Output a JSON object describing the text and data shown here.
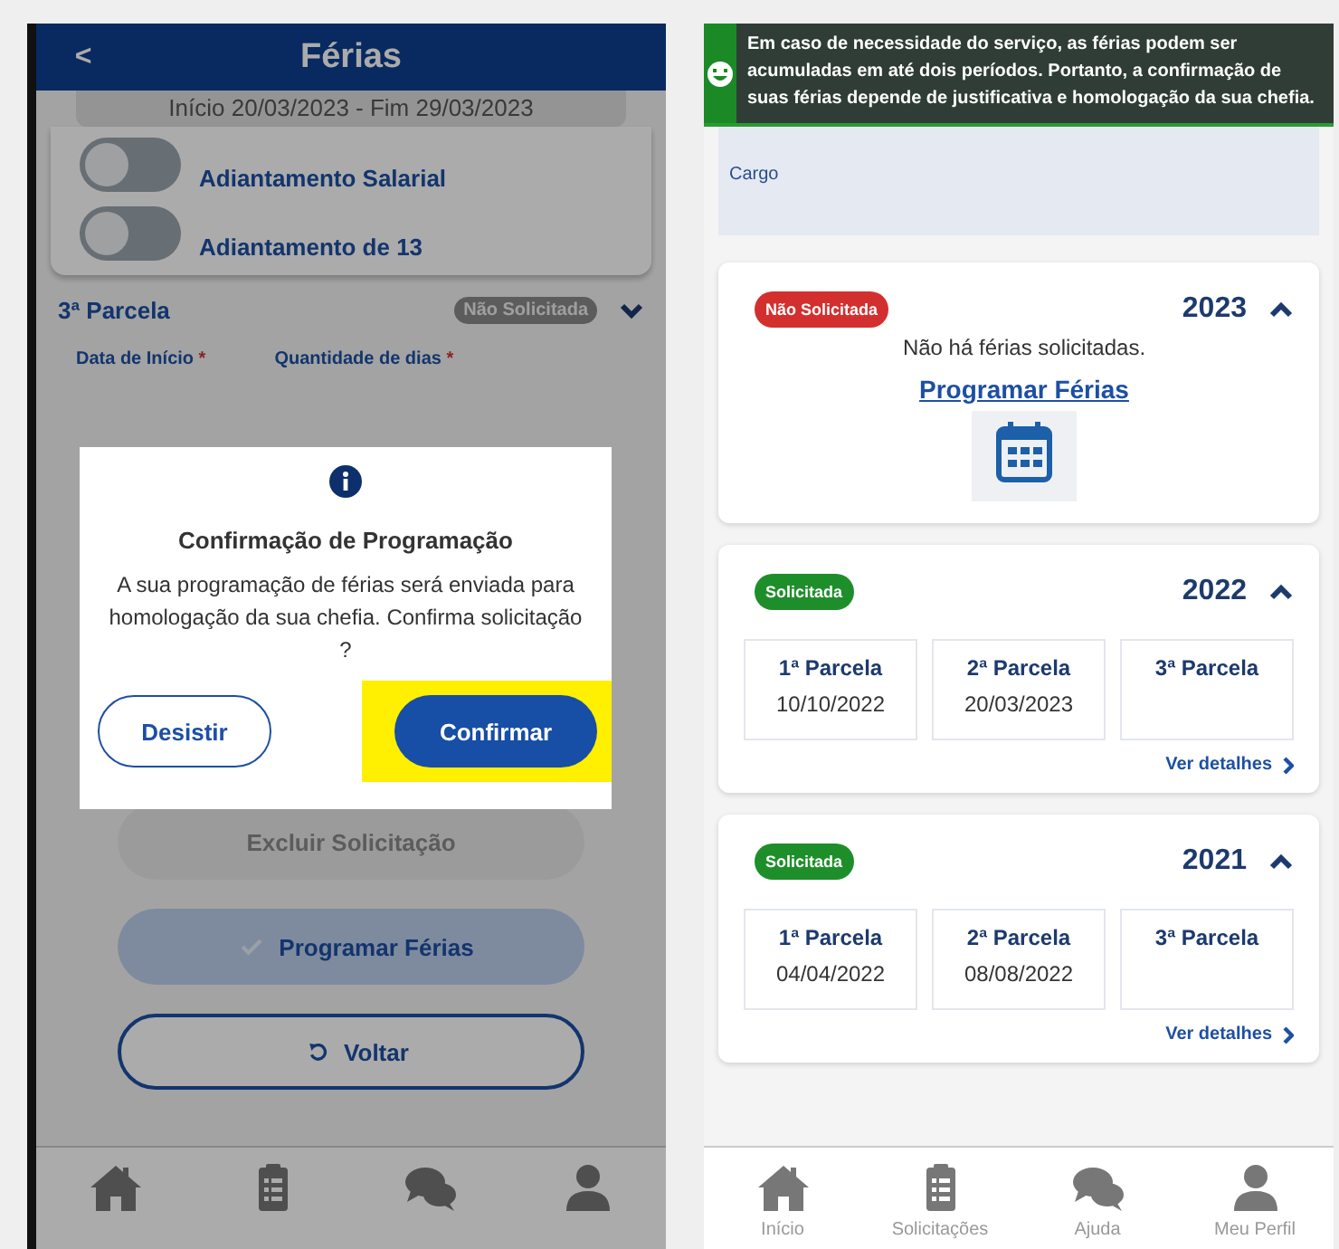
{
  "left_screen": {
    "header": {
      "back": "<",
      "title": "Férias"
    },
    "period": "Início 20/03/2023 - Fim 29/03/2023",
    "toggles": [
      {
        "label": "Adiantamento Salarial",
        "on": false
      },
      {
        "label": "Adiantamento de 13",
        "on": false
      }
    ],
    "parcel": {
      "title": "3ª Parcela",
      "status": "Não Solicitada",
      "expanded": false,
      "fields": [
        {
          "label": "Data de Início",
          "mark": "*"
        },
        {
          "label": "Quantidade de dias",
          "mark": "*"
        }
      ]
    },
    "actions": [
      {
        "label": "Excluir Solicitação",
        "kind": "disabled"
      },
      {
        "label": "Programar Férias",
        "kind": "primary"
      },
      {
        "label": "Voltar",
        "kind": "outline"
      }
    ],
    "dialog": {
      "title": "Confirmação de Programação",
      "message": "A sua programação de férias será enviada para homologação da sua chefia. Confirma solicitação ?",
      "buttons": [
        {
          "label": "Desistir",
          "kind": "outline",
          "highlighted": false
        },
        {
          "label": "Confirmar",
          "kind": "primary",
          "highlighted": true
        }
      ]
    },
    "nav": [
      {
        "kind": "home"
      },
      {
        "kind": "clipboard"
      },
      {
        "kind": "chat"
      },
      {
        "kind": "user"
      }
    ]
  },
  "right_screen": {
    "toast": {
      "kind": "success",
      "message": "Em caso de necessidade do serviço, as férias podem ser acumuladas em até dois períodos. Portanto, a confirmação de suas férias depende de justificativa e homologação da sua chefia."
    },
    "profile": {
      "label": "Cargo"
    },
    "years": [
      {
        "year": "2023",
        "status": "Não Solicitada",
        "color": "#d32f2f",
        "expanded": true,
        "kind": "empty",
        "message": "Não há férias solicitadas.",
        "link": "Programar Férias"
      },
      {
        "year": "2022",
        "status": "Solicitada",
        "color": "#1e8e2a",
        "expanded": true,
        "kind": "parcels",
        "parcels": [
          {
            "title": "1ª Parcela",
            "date": "10/10/2022"
          },
          {
            "title": "2ª Parcela",
            "date": "20/03/2023"
          },
          {
            "title": "3ª Parcela"
          }
        ],
        "details": "Ver detalhes"
      },
      {
        "year": "2021",
        "status": "Solicitada",
        "color": "#1e8e2a",
        "expanded": true,
        "kind": "parcels",
        "parcels": [
          {
            "title": "1ª Parcela",
            "date": "04/04/2022"
          },
          {
            "title": "2ª Parcela",
            "date": "08/08/2022"
          },
          {
            "title": "3ª Parcela"
          }
        ],
        "details": "Ver detalhes"
      }
    ],
    "nav": [
      {
        "kind": "home",
        "label": "Início"
      },
      {
        "kind": "clipboard",
        "label": "Solicitações"
      },
      {
        "kind": "chat",
        "label": "Ajuda"
      },
      {
        "kind": "user",
        "label": "Meu Perfil"
      }
    ]
  }
}
